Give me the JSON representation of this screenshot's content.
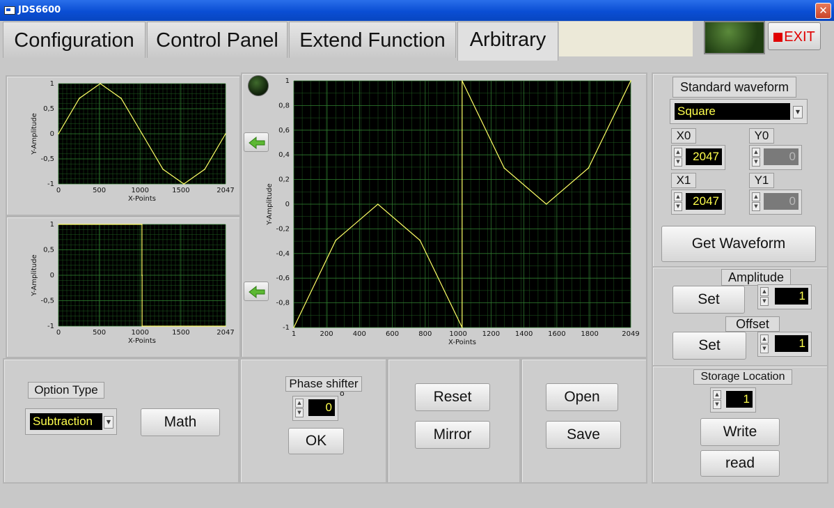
{
  "window": {
    "title": "JDS6600"
  },
  "tabs": [
    {
      "label": "Configuration"
    },
    {
      "label": "Control Panel"
    },
    {
      "label": "Extend Function"
    },
    {
      "label": "Arbitrary"
    }
  ],
  "exit_label": "EXIT",
  "standard_waveform": {
    "title": "Standard waveform",
    "selected": "Square",
    "x0_label": "X0",
    "x0": "2047",
    "y0_label": "Y0",
    "y0": "0",
    "x1_label": "X1",
    "x1": "2047",
    "y1_label": "Y1",
    "y1": "0",
    "get_label": "Get Waveform"
  },
  "amplitude": {
    "title": "Amplitude",
    "set_label": "Set",
    "value": "1"
  },
  "offset": {
    "title": "Offset",
    "set_label": "Set",
    "value": "1"
  },
  "storage": {
    "title": "Storage Location",
    "value": "1",
    "write_label": "Write",
    "read_label": "read"
  },
  "option_type": {
    "title": "Option Type",
    "selected": "Subtraction",
    "math_label": "Math"
  },
  "phase_shifter": {
    "title": "Phase shifter",
    "value": "0",
    "unit": "o",
    "ok_label": "OK"
  },
  "edit": {
    "reset_label": "Reset",
    "mirror_label": "Mirror"
  },
  "file": {
    "open_label": "Open",
    "save_label": "Save"
  },
  "icons": {
    "left": "arrow-left-icon"
  },
  "colors": {
    "plot_bg": "#000000",
    "grid": "#1f5a1f",
    "trace": "#ffff66",
    "accent_text": "#ffff4d"
  },
  "chart_data": [
    {
      "type": "line",
      "xlabel": "X-Points",
      "ylabel": "Y-Amplitude",
      "xlim": [
        0,
        2047
      ],
      "ylim": [
        -1,
        1
      ],
      "xticks": [
        "0",
        "500",
        "1000",
        "1500",
        "2047"
      ],
      "yticks": [
        "1",
        "0,5",
        "0",
        "-0,5",
        "-1"
      ],
      "grid": true,
      "series": [
        {
          "x": [
            0,
            256,
            512,
            768,
            1024,
            1280,
            1536,
            1792,
            2047
          ],
          "y": [
            0,
            0.707,
            1,
            0.707,
            0,
            -0.707,
            -1,
            -0.707,
            0
          ]
        }
      ]
    },
    {
      "type": "line",
      "xlabel": "X-Points",
      "ylabel": "Y-Amplitude",
      "xlim": [
        0,
        2047
      ],
      "ylim": [
        -1,
        1
      ],
      "xticks": [
        "0",
        "500",
        "1000",
        "1500",
        "2047"
      ],
      "yticks": [
        "1",
        "0,5",
        "0",
        "-0,5",
        "-1"
      ],
      "grid": true,
      "series": [
        {
          "x": [
            0,
            1023,
            1023,
            1024,
            1024,
            2047
          ],
          "y": [
            1,
            1,
            0,
            0,
            -1,
            -1
          ]
        }
      ]
    },
    {
      "type": "line",
      "xlabel": "X-Points",
      "ylabel": "Y-Amplitude",
      "xlim": [
        1,
        2049
      ],
      "ylim": [
        -1,
        1
      ],
      "xticks": [
        "1",
        "200",
        "400",
        "600",
        "800",
        "1000",
        "1200",
        "1400",
        "1600",
        "1800",
        "2049"
      ],
      "yticks": [
        "1",
        "0,8",
        "0,6",
        "0,4",
        "0,2",
        "0",
        "-0,2",
        "-0,4",
        "-0,6",
        "-0,8",
        "-1"
      ],
      "grid": true,
      "series": [
        {
          "x": [
            1,
            256,
            512,
            768,
            1024,
            1024,
            1280,
            1536,
            1792,
            2049
          ],
          "y": [
            -1,
            -0.293,
            0,
            -0.293,
            -1,
            1,
            0.293,
            0,
            0.293,
            1
          ]
        }
      ]
    }
  ]
}
